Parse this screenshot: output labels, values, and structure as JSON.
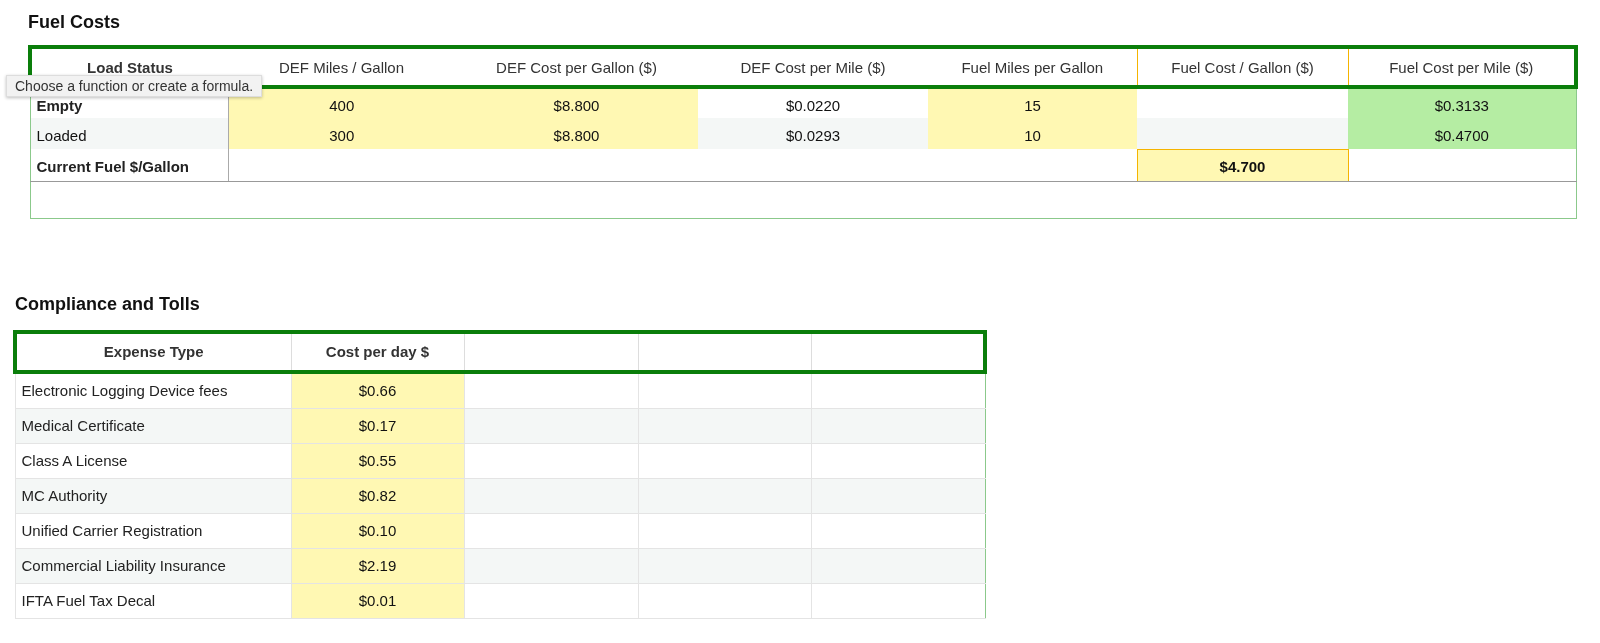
{
  "fuel_costs": {
    "title": "Fuel Costs",
    "columns": [
      {
        "label": "Load Status",
        "bold": true
      },
      {
        "label": "DEF Miles / Gallon",
        "bold": false
      },
      {
        "label": "DEF Cost per Gallon ($)",
        "bold": false
      },
      {
        "label": "DEF Cost per Mile ($)",
        "bold": false
      },
      {
        "label": "Fuel Miles per Gallon",
        "bold": false
      },
      {
        "label": "Fuel Cost / Gallon ($)",
        "bold": false
      },
      {
        "label": "Fuel Cost per Mile ($)",
        "bold": false
      }
    ],
    "rows": [
      {
        "cells": [
          {
            "value": "Empty",
            "kind": "heading"
          },
          {
            "value": "400",
            "kind": "input"
          },
          {
            "value": "$8.800",
            "kind": "input"
          },
          {
            "value": "$0.0220",
            "kind": "plain"
          },
          {
            "value": "15",
            "kind": "input"
          },
          {
            "kind": "plain"
          },
          {
            "value": "$0.3133",
            "kind": "result"
          }
        ]
      },
      {
        "cells": [
          {
            "value": "Loaded",
            "kind": "label"
          },
          {
            "value": "300",
            "kind": "input"
          },
          {
            "value": "$8.800",
            "kind": "input"
          },
          {
            "value": "$0.0293",
            "kind": "plain"
          },
          {
            "value": "10",
            "kind": "input"
          },
          {
            "kind": "plain"
          },
          {
            "value": "$0.4700",
            "kind": "result"
          }
        ]
      },
      {
        "cells": [
          {
            "value": "Current Fuel $/Gallon",
            "kind": "heading"
          },
          {
            "kind": "plain"
          },
          {
            "kind": "plain"
          },
          {
            "kind": "plain"
          },
          {
            "kind": "plain"
          },
          {
            "value": "$4.700",
            "kind": "active"
          },
          {
            "kind": "plain"
          }
        ]
      }
    ],
    "tooltip": "Choose a function or create a formula."
  },
  "compliance": {
    "title": "Compliance and Tolls",
    "columns": [
      "Expense Type",
      "Cost per day  $"
    ],
    "rows": [
      {
        "label": "Electronic Logging Device fees",
        "cost": "$0.66"
      },
      {
        "label": "Medical Certificate",
        "cost": "$0.17"
      },
      {
        "label": "Class A License",
        "cost": "$0.55"
      },
      {
        "label": "MC Authority",
        "cost": "$0.82"
      },
      {
        "label": "Unified Carrier Registration",
        "cost": "$0.10"
      },
      {
        "label": "Commercial Liability Insurance",
        "cost": "$2.19"
      },
      {
        "label": "IFTA Fuel Tax Decal",
        "cost": "$0.01"
      }
    ]
  }
}
